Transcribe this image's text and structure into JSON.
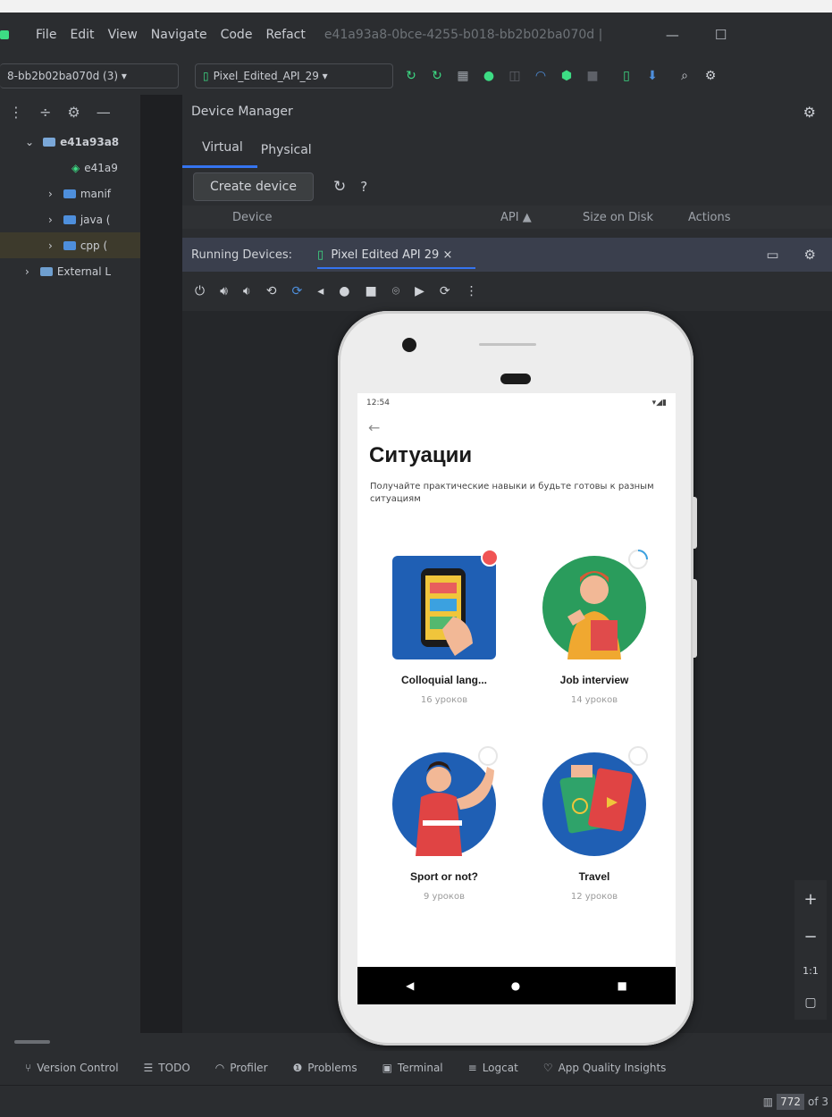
{
  "menu": {
    "items": [
      "File",
      "Edit",
      "View",
      "Navigate",
      "Code",
      "Refact"
    ],
    "project_title": "e41a93a8-0bce-4255-b018-bb2b02ba070d |",
    "minimize": "—",
    "maximize": "☐"
  },
  "toolbar": {
    "module_combo": "8-bb2b02ba070d (3) ▾",
    "device_combo": "Pixel_Edited_API_29 ▾"
  },
  "project_tree": {
    "items": [
      {
        "label": "e41a93a8",
        "indent": 0
      },
      {
        "label": "e41a9",
        "indent": 1
      },
      {
        "label": "manif",
        "indent": 1
      },
      {
        "label": "java (",
        "indent": 1
      },
      {
        "label": "cpp (",
        "indent": 1
      },
      {
        "label": "External L",
        "indent": 0
      }
    ]
  },
  "device_manager": {
    "title": "Device Manager",
    "tabs": [
      "Virtual",
      "Physical"
    ],
    "create_button": "Create device",
    "help": "?",
    "columns": [
      "Device",
      "API ▲",
      "Size on Disk",
      "Actions"
    ]
  },
  "running_devices": {
    "label": "Running Devices:",
    "tab": "Pixel Edited API 29 ×"
  },
  "app": {
    "status_time": "12:54",
    "title": "Ситуации",
    "subtitle": "Получайте практические навыки и будьте готовы к разным ситуациям",
    "cards": [
      {
        "label": "Colloquial lang...",
        "count": "16 уроков",
        "accent": "#1f5fb4"
      },
      {
        "label": "Job interview",
        "count": "14 уроков",
        "accent": "#2a9c5c"
      },
      {
        "label": "Sport or not?",
        "count": "9 уроков",
        "accent": "#1f5fb4"
      },
      {
        "label": "Travel",
        "count": "12 уроков",
        "accent": "#1f5fb4"
      }
    ]
  },
  "zoom": {
    "plus": "+",
    "minus": "−",
    "ratio": "1:1"
  },
  "bottom_tools": [
    "Version Control",
    "TODO",
    "Profiler",
    "Problems",
    "Terminal",
    "Logcat",
    "App Quality Insights"
  ],
  "status": {
    "page": "772",
    "of": "of 3"
  },
  "colors": {
    "accent": "#3574f0",
    "ide_bg": "#2b2d30",
    "badge_red": "#f05454"
  }
}
